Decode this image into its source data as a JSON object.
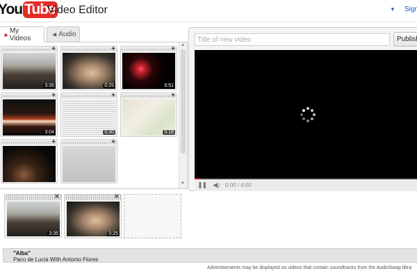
{
  "header": {
    "logo_you": "You",
    "logo_tube": "Tube",
    "title": "Video Editor",
    "sign_in": "Sign"
  },
  "library": {
    "tabs": [
      {
        "label": "My Videos",
        "icon": "video-icon",
        "active": true
      },
      {
        "label": "Audio",
        "icon": "speaker-icon",
        "active": false
      }
    ],
    "clips": [
      {
        "duration": "3:35",
        "thumb": "street"
      },
      {
        "duration": "0:25",
        "thumb": "hands"
      },
      {
        "duration": "5:51",
        "thumb": "fire"
      },
      {
        "duration": "3:04",
        "thumb": "concert"
      },
      {
        "duration": "0:30",
        "thumb": "screen"
      },
      {
        "duration": "0:18",
        "thumb": "map"
      },
      {
        "duration": "",
        "thumb": "dark"
      },
      {
        "duration": "",
        "thumb": "gray"
      }
    ]
  },
  "player": {
    "title_placeholder": "Title of new video",
    "title_value": "",
    "publish_label": "Publish",
    "time": "0:00 / 4:00",
    "progress_fraction": 0.02
  },
  "timeline": {
    "clips": [
      {
        "duration": "3:35",
        "thumb": "street"
      },
      {
        "duration": "0:25",
        "thumb": "hands"
      }
    ]
  },
  "audio_track": {
    "title": "\"Alba\"",
    "artist": "Paco de Lucia With Antonio Flores"
  },
  "disclaimer": "Advertisements may be displayed on videos that contain soundtracks from the AudioSwap libra",
  "colors": {
    "brand_red": "#e52d27",
    "link_blue": "#1155cc"
  }
}
